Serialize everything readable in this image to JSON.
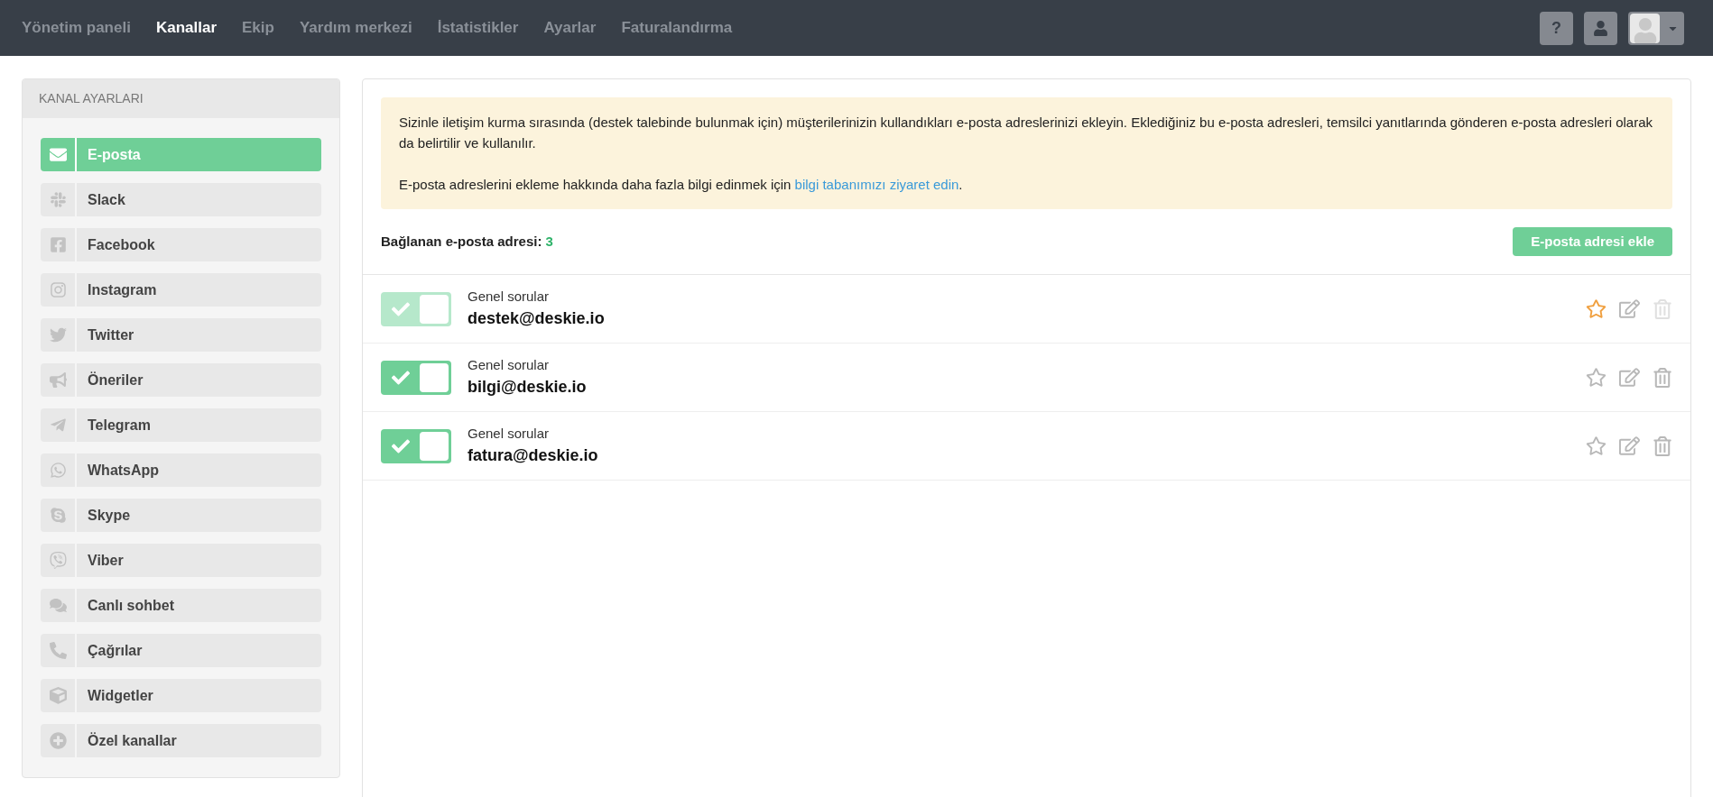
{
  "nav": {
    "items": [
      {
        "label": "Yönetim paneli",
        "selected": false
      },
      {
        "label": "Kanallar",
        "selected": true
      },
      {
        "label": "Ekip",
        "selected": false
      },
      {
        "label": "Yardım merkezi",
        "selected": false
      },
      {
        "label": "İstatistikler",
        "selected": false
      },
      {
        "label": "Ayarlar",
        "selected": false
      },
      {
        "label": "Faturalandırma",
        "selected": false
      }
    ],
    "help_button": "?"
  },
  "sidebar": {
    "title": "KANAL AYARLARI",
    "items": [
      {
        "label": "E-posta",
        "selected": true
      },
      {
        "label": "Slack",
        "selected": false
      },
      {
        "label": "Facebook",
        "selected": false
      },
      {
        "label": "Instagram",
        "selected": false
      },
      {
        "label": "Twitter",
        "selected": false
      },
      {
        "label": "Öneriler",
        "selected": false
      },
      {
        "label": "Telegram",
        "selected": false
      },
      {
        "label": "WhatsApp",
        "selected": false
      },
      {
        "label": "Skype",
        "selected": false
      },
      {
        "label": "Viber",
        "selected": false
      },
      {
        "label": "Canlı sohbet",
        "selected": false
      },
      {
        "label": "Çağrılar",
        "selected": false
      },
      {
        "label": "Widgetler",
        "selected": false
      },
      {
        "label": "Özel kanallar",
        "selected": false
      }
    ]
  },
  "notice": {
    "text": "Sizinle iletişim kurma sırasında (destek talebinde bulunmak için) müşterilerinizin kullandıkları e-posta adreslerinizi ekleyin. Eklediğiniz bu e-posta adresleri, temsilci yanıtlarında gönderen e-posta adresleri olarak da belirtilir ve kullanılır.",
    "more_text": "E-posta adreslerini ekleme hakkında daha fazla bilgi edinmek için",
    "link": "bilgi tabanımızı ziyaret edin",
    "after_link": "."
  },
  "summary": {
    "label": "Bağlanan e-posta adresi:",
    "count": "3",
    "add_button": "E-posta adresi ekle"
  },
  "addresses": [
    {
      "group": "Genel sorular",
      "email": "destek@deskie.io",
      "on": true,
      "locked": true,
      "primary": true
    },
    {
      "group": "Genel sorular",
      "email": "bilgi@deskie.io",
      "on": true,
      "locked": false,
      "primary": false
    },
    {
      "group": "Genel sorular",
      "email": "fatura@deskie.io",
      "on": true,
      "locked": false,
      "primary": false
    }
  ]
}
